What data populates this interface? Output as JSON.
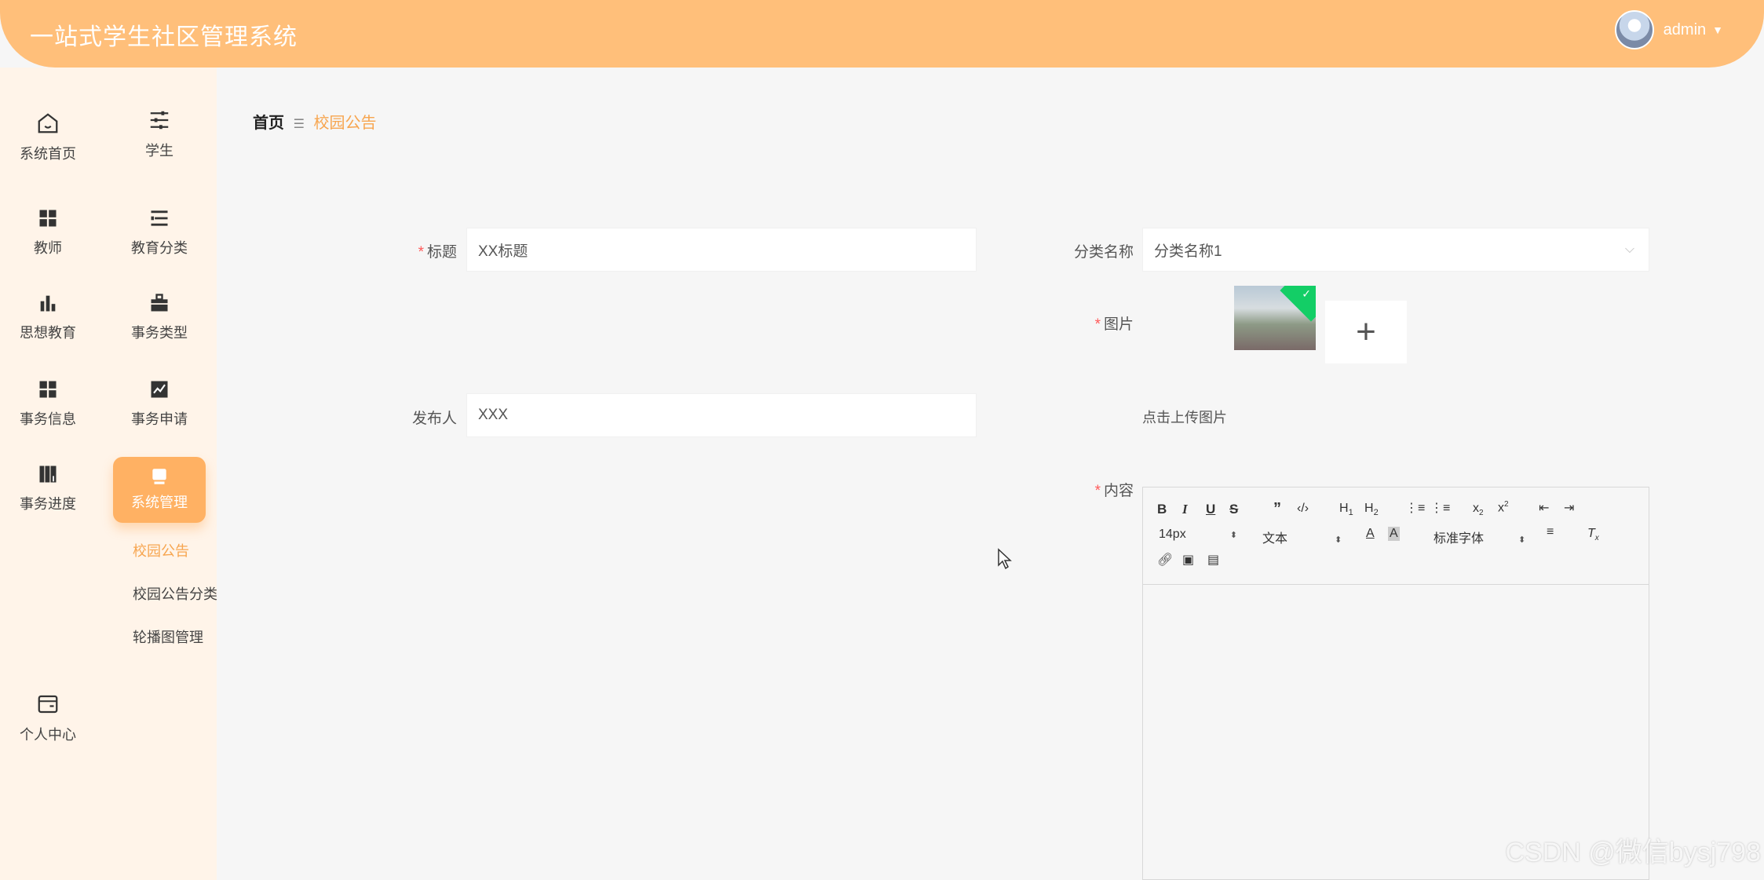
{
  "header": {
    "title": "一站式学生社区管理系统",
    "username": "admin"
  },
  "sidebar": {
    "items": [
      {
        "label": "系统首页",
        "icon": "home-icon"
      },
      {
        "label": "学生",
        "icon": "sliders-icon"
      },
      {
        "label": "教师",
        "icon": "grid-icon"
      },
      {
        "label": "教育分类",
        "icon": "list-icon"
      },
      {
        "label": "思想教育",
        "icon": "bar-chart-icon"
      },
      {
        "label": "事务类型",
        "icon": "briefcase-icon"
      },
      {
        "label": "事务信息",
        "icon": "grid-icon"
      },
      {
        "label": "事务申请",
        "icon": "trend-chart-icon"
      },
      {
        "label": "事务进度",
        "icon": "book-icon"
      },
      {
        "label": "系统管理",
        "icon": "monitor-icon"
      },
      {
        "label": "个人中心",
        "icon": "wallet-icon"
      }
    ],
    "subitems": [
      {
        "label": "校园公告"
      },
      {
        "label": "校园公告分类"
      },
      {
        "label": "轮播图管理"
      }
    ]
  },
  "breadcrumb": {
    "home": "首页",
    "current": "校园公告"
  },
  "form": {
    "title_label": "标题",
    "title_value": "XX标题",
    "publisher_label": "发布人",
    "publisher_value": "XXX",
    "category_label": "分类名称",
    "category_value": "分类名称1",
    "image_label": "图片",
    "upload_hint": "点击上传图片",
    "content_label": "内容"
  },
  "editor": {
    "font_size": "14px",
    "block_type": "文本",
    "font_family": "标准字体"
  },
  "watermark": "CSDN @微信bysj798",
  "colors": {
    "accent": "#ffbf7a",
    "active": "#ffb163",
    "link": "#f7a54f",
    "required": "#ff5a5a"
  }
}
